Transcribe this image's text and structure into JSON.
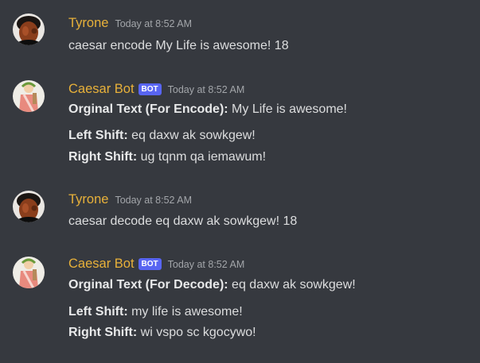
{
  "messages": [
    {
      "username": "Tyrone",
      "timestamp": "Today at 8:52 AM",
      "text": "caesar encode My Life is awesome! 18"
    },
    {
      "username": "Caesar Bot",
      "badge": "BOT",
      "timestamp": "Today at 8:52 AM",
      "lines": [
        {
          "label": "Orginal Text (For Encode):",
          "value": " My Life is awesome!"
        },
        {
          "label": "Left Shift:",
          "value": " eq daxw ak sowkgew!"
        },
        {
          "label": "Right Shift:",
          "value": " ug tqnm qa iemawum!"
        }
      ]
    },
    {
      "username": "Tyrone",
      "timestamp": "Today at 8:52 AM",
      "text": "caesar decode eq daxw ak sowkgew! 18"
    },
    {
      "username": "Caesar Bot",
      "badge": "BOT",
      "timestamp": "Today at 8:52 AM",
      "lines": [
        {
          "label": "Orginal Text (For Decode):",
          "value": " eq daxw ak sowkgew!"
        },
        {
          "label": "Left Shift:",
          "value": " my life is awesome!"
        },
        {
          "label": "Right Shift:",
          "value": " wi vspo sc kgocywo!"
        }
      ]
    }
  ],
  "colors": {
    "background": "#36393f",
    "username": "#e8b13a",
    "bot_badge": "#5865f2",
    "timestamp": "#a3a6aa",
    "text": "#dcddde"
  },
  "icons": {
    "user_avatar": "user-avatar-icon",
    "bot_avatar": "bot-avatar-icon"
  }
}
